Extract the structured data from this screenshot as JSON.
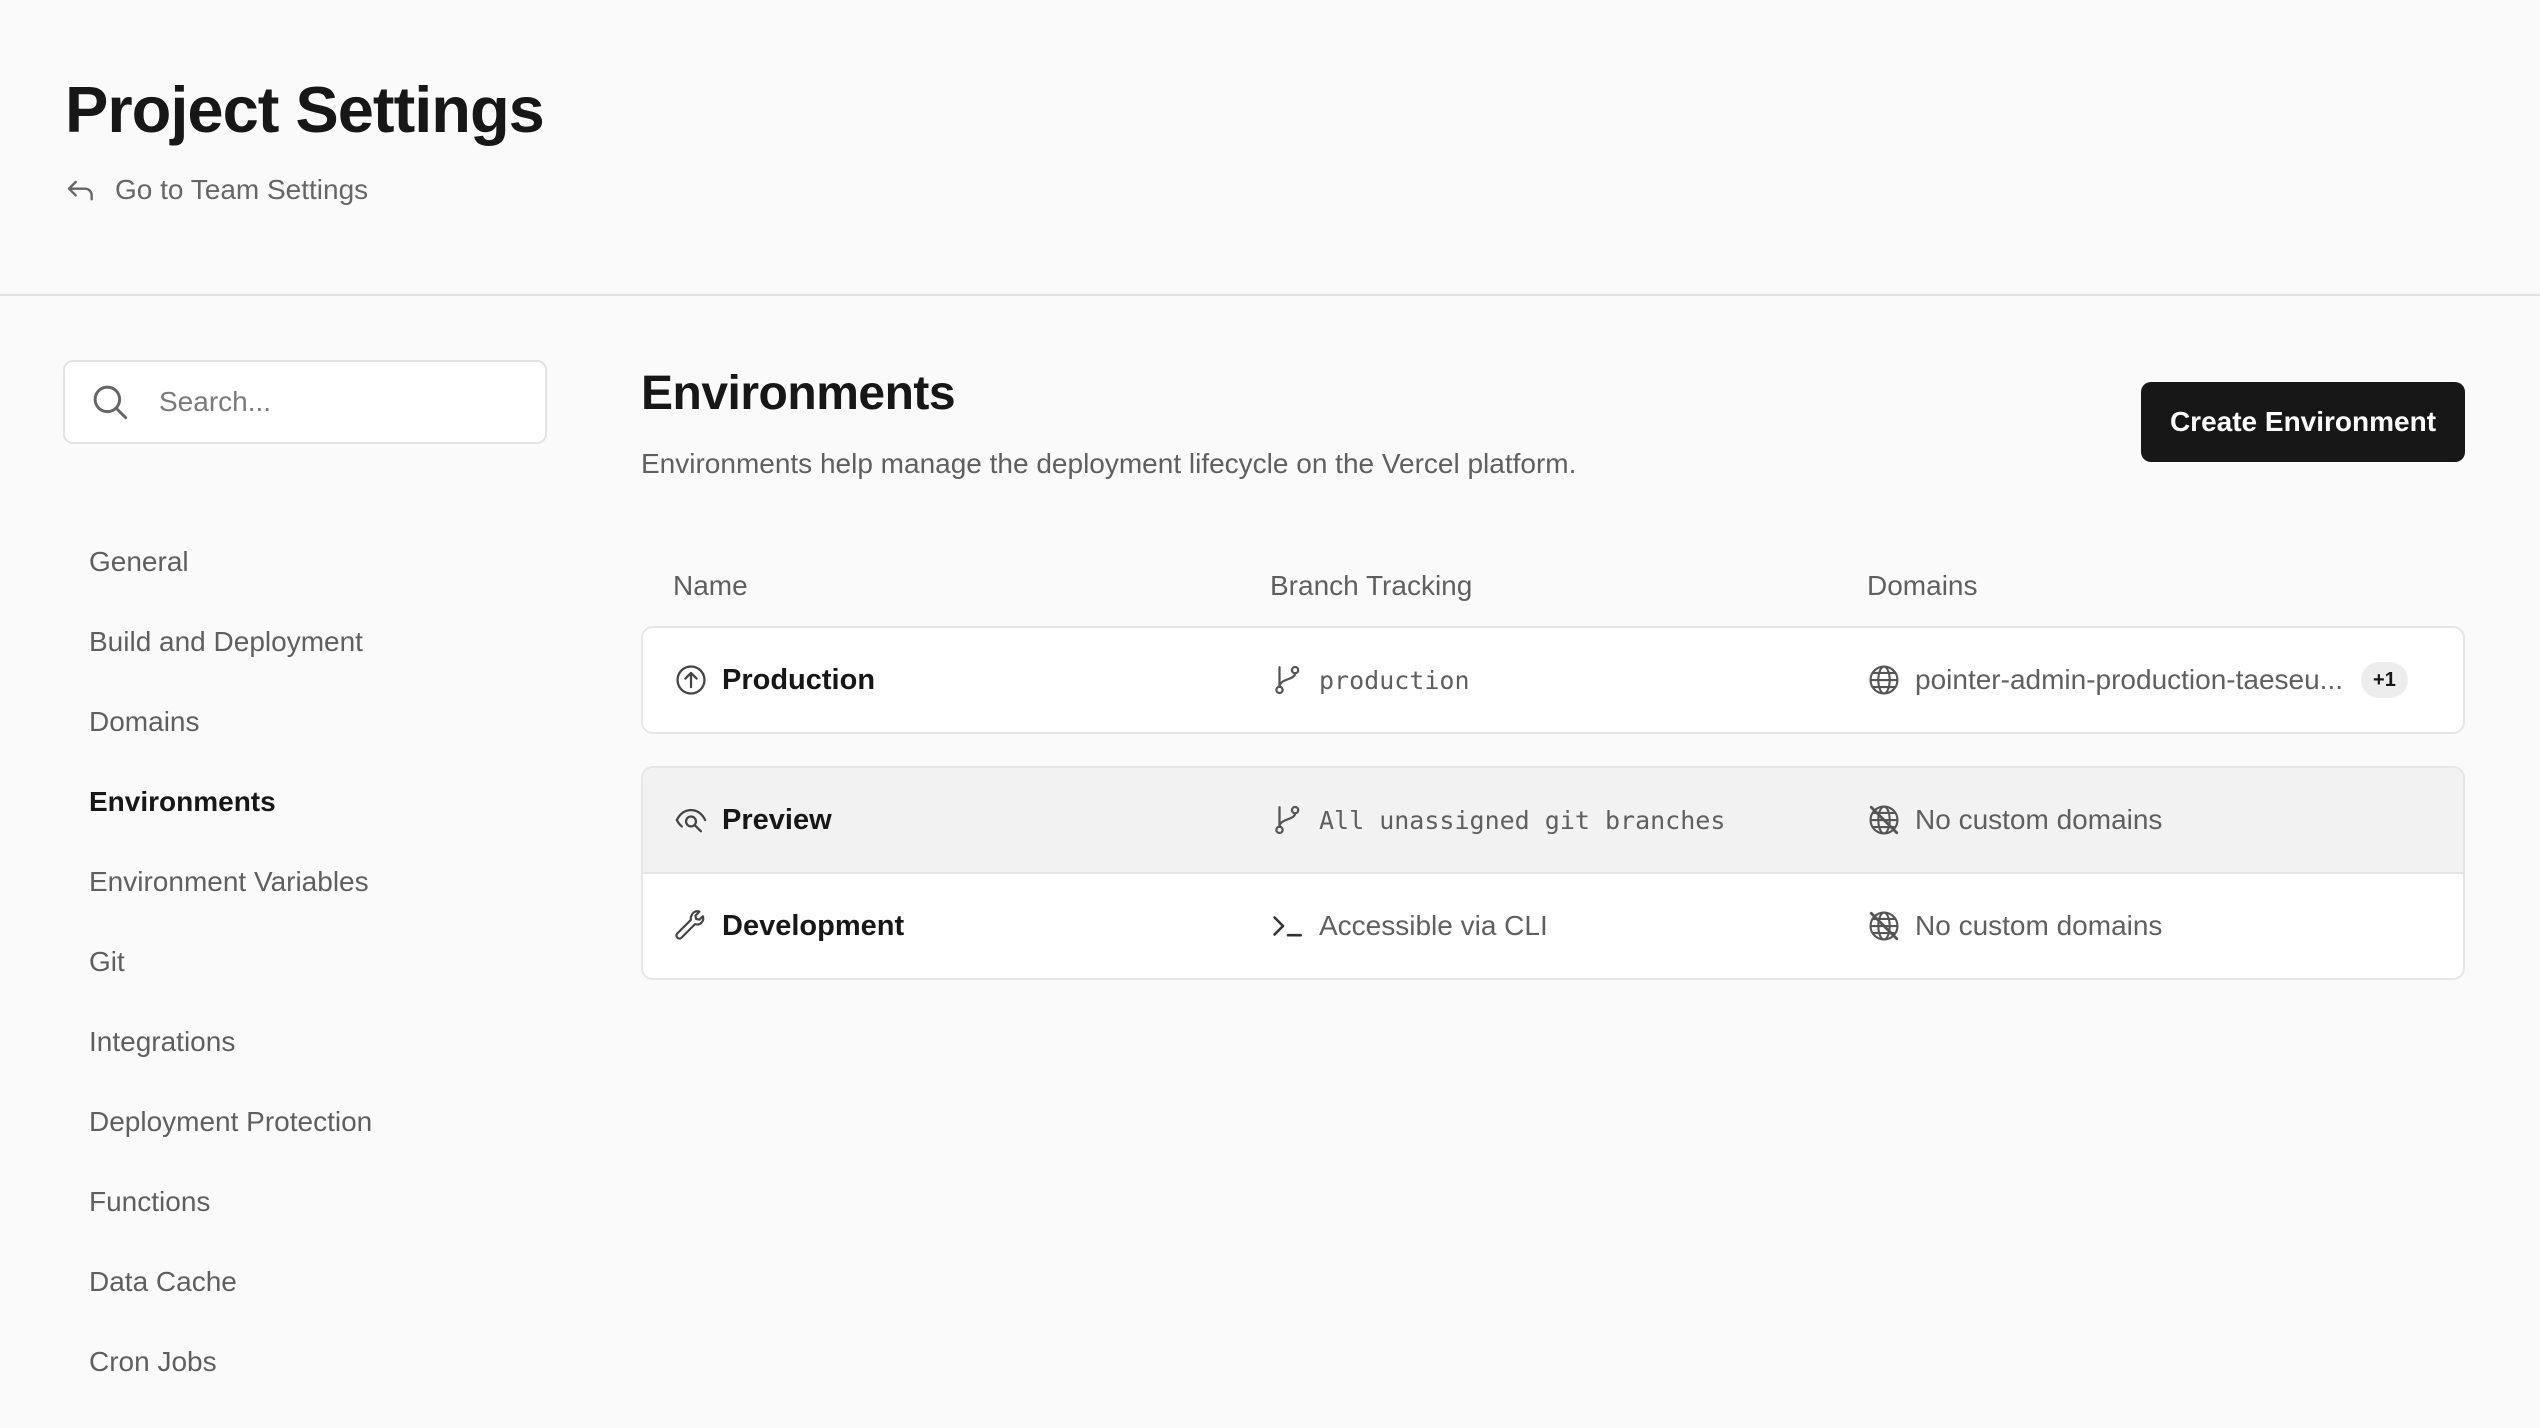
{
  "header": {
    "title": "Project Settings",
    "back_link": "Go to Team Settings"
  },
  "sidebar": {
    "search_placeholder": "Search...",
    "items": [
      {
        "label": "General",
        "active": false
      },
      {
        "label": "Build and Deployment",
        "active": false
      },
      {
        "label": "Domains",
        "active": false
      },
      {
        "label": "Environments",
        "active": true
      },
      {
        "label": "Environment Variables",
        "active": false
      },
      {
        "label": "Git",
        "active": false
      },
      {
        "label": "Integrations",
        "active": false
      },
      {
        "label": "Deployment Protection",
        "active": false
      },
      {
        "label": "Functions",
        "active": false
      },
      {
        "label": "Data Cache",
        "active": false
      },
      {
        "label": "Cron Jobs",
        "active": false
      }
    ]
  },
  "main": {
    "title": "Environments",
    "description": "Environments help manage the deployment lifecycle on the Vercel platform.",
    "create_button": "Create Environment",
    "columns": [
      "Name",
      "Branch Tracking",
      "Domains"
    ],
    "environments": [
      {
        "name": "Production",
        "icon": "arrow-up-circle-icon",
        "branch": "production",
        "branch_icon": "git-branch-icon",
        "domain": "pointer-admin-production-taeseu...",
        "domain_icon": "globe-icon",
        "extra_badge": "+1"
      },
      {
        "name": "Preview",
        "icon": "eye-icon",
        "branch": "All unassigned git branches",
        "branch_icon": "git-branch-icon",
        "domain": "No custom domains",
        "domain_icon": "globe-off-icon"
      },
      {
        "name": "Development",
        "icon": "wrench-icon",
        "branch": "Accessible via CLI",
        "branch_icon": "terminal-icon",
        "domain": "No custom domains",
        "domain_icon": "globe-off-icon"
      }
    ]
  },
  "colors": {
    "background": "#fafafa",
    "text_primary": "#171717",
    "text_secondary": "#5f5f5f",
    "button_bg": "#171717",
    "button_text": "#ffffff",
    "row_hover": "#f2f2f2",
    "border": "#e6e6e6"
  }
}
